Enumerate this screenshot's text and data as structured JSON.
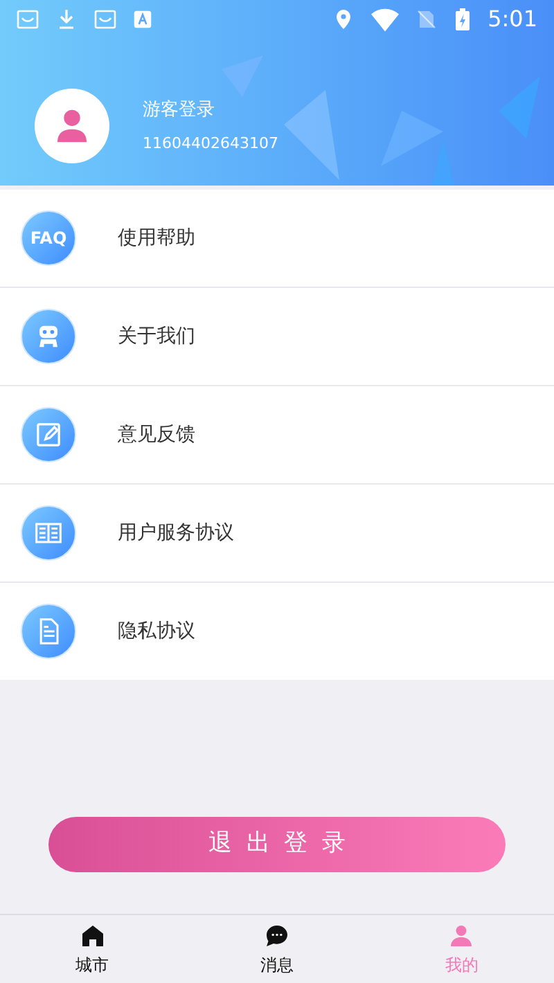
{
  "status_bar": {
    "time": "5:01"
  },
  "profile": {
    "name": "游客登录",
    "id": "11604402643107"
  },
  "menu": [
    {
      "kind": "faq",
      "badge": "FAQ",
      "label": "使用帮助"
    },
    {
      "kind": "robot",
      "label": "关于我们"
    },
    {
      "kind": "edit",
      "label": "意见反馈"
    },
    {
      "kind": "book",
      "label": "用户服务协议"
    },
    {
      "kind": "document",
      "label": "隐私协议"
    }
  ],
  "logout_button": "退出登录",
  "nav": [
    {
      "kind": "home",
      "label": "城市",
      "selected": false
    },
    {
      "kind": "chat",
      "label": "消息",
      "selected": false
    },
    {
      "kind": "person",
      "label": "我的",
      "selected": true
    }
  ]
}
